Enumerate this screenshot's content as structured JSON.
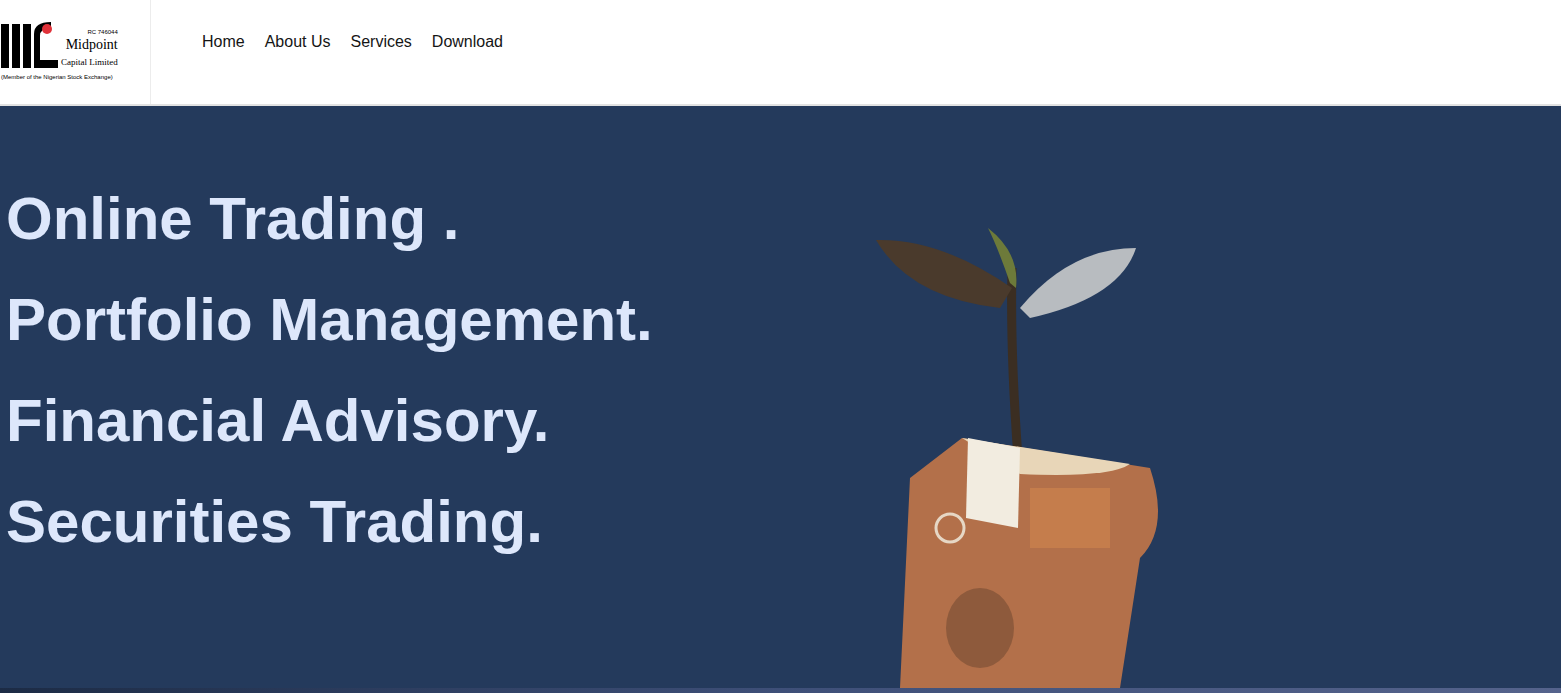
{
  "logo": {
    "registration": "RC 746044",
    "name": "Midpoint",
    "subtitle": "Capital Limited",
    "member_note": "(Member of the Nigerian Stock Exchange)"
  },
  "nav": [
    {
      "label": "Home",
      "selected": false
    },
    {
      "label": "About Us",
      "selected": false
    },
    {
      "label": "Services",
      "selected": false
    },
    {
      "label": "Download",
      "selected": false
    }
  ],
  "hero": {
    "lines": [
      "Online Trading .",
      "Portfolio Management.",
      "Financial Advisory.",
      "Securities Trading."
    ]
  }
}
